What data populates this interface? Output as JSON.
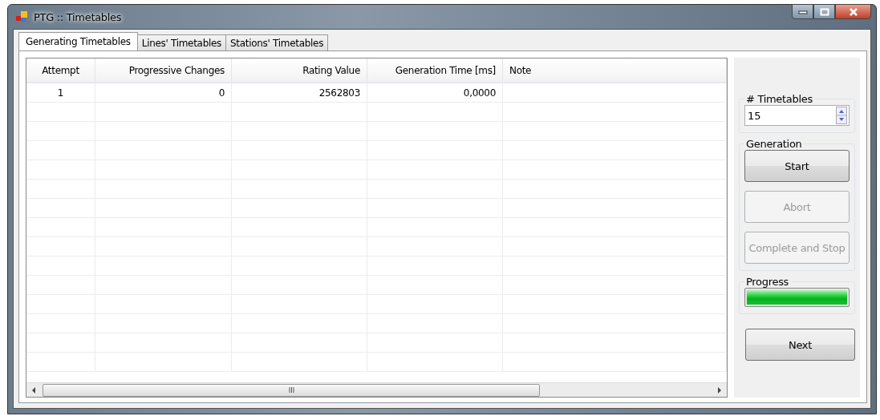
{
  "window": {
    "title": "PTG :: Timetables"
  },
  "tabs": [
    {
      "label": "Generating Timetables",
      "selected": true
    },
    {
      "label": "Lines' Timetables",
      "selected": false
    },
    {
      "label": "Stations' Timetables",
      "selected": false
    }
  ],
  "table": {
    "columns": [
      "Attempt",
      "Progressive Changes",
      "Rating Value",
      "Generation Time [ms]",
      "Note"
    ],
    "rows": [
      [
        "1",
        "0",
        "2562803",
        "0,0000",
        ""
      ]
    ]
  },
  "timetables_group": {
    "label": "# Timetables",
    "value": "15"
  },
  "generation_group": {
    "label": "Generation",
    "buttons": [
      {
        "label": "Start",
        "disabled": false
      },
      {
        "label": "Abort",
        "disabled": true
      },
      {
        "label": "Complete and Stop",
        "disabled": true
      }
    ]
  },
  "progress_group": {
    "label": "Progress",
    "level": 1.0
  },
  "next_button": {
    "label": "Next",
    "disabled": false
  }
}
